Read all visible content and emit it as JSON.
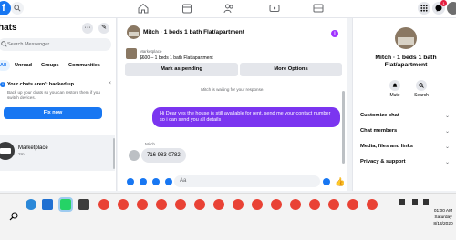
{
  "topnav": {
    "logo_letter": "f",
    "badge_count": "1"
  },
  "sidebar": {
    "title": "hats",
    "more_label": "···",
    "compose_label": "✎",
    "search_placeholder": "Search Messenger",
    "tabs": [
      "All",
      "Unread",
      "Groups",
      "Communities"
    ],
    "backup": {
      "title": "Your chats aren't backed up",
      "text": "Back up your chats so you can restore them if you switch devices.",
      "button": "Fix now",
      "close": "×"
    },
    "chat": {
      "name": "Marketplace",
      "time": "2m"
    }
  },
  "conversation": {
    "title": "Mitch · 1 beds 1 bath Flat/apartment",
    "info_label": "i",
    "listing_source": "Marketplace",
    "listing_price": "$600 – 1 beds 1 bath Flat/apartment",
    "mark_pending": "Mark as pending",
    "more_options": "More Options",
    "waiting": "Mitch is waiting for your response.",
    "outgoing": "Hi Dear yes the house is still available for rent, send me your contact number so i can send you all details",
    "sender": "Mitch",
    "incoming": "716 983 0782",
    "composer_placeholder": "Aa",
    "like": "👍"
  },
  "details": {
    "name": "Mitch · 1 beds 1 bath Flat/apartment",
    "mute": "Mute",
    "search": "Search",
    "items": [
      "Customize chat",
      "Chat members",
      "Media, files and links",
      "Privacy & support"
    ]
  },
  "taskbar": {
    "time": "01:00 AM",
    "day": "Saturday",
    "date": "8/13/2020"
  },
  "colors": {
    "brand": "#1877f2",
    "outgoing_bubble": "#7b35f0",
    "info": "#a033ff"
  }
}
